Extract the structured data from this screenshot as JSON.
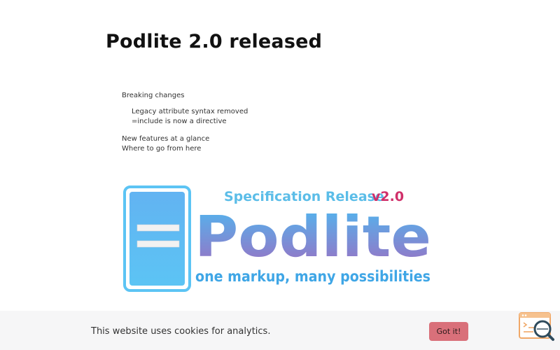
{
  "article": {
    "title": "Podlite 2.0 released"
  },
  "toc": {
    "items": [
      {
        "label": "Breaking changes"
      },
      {
        "label": "Legacy attribute syntax removed"
      },
      {
        "label": "=include is now a directive"
      },
      {
        "label": "New features at a glance"
      },
      {
        "label": "Where to go from here"
      }
    ]
  },
  "banner": {
    "release_label": "Specification Release",
    "version": "v2.0",
    "wordmark": "Podlite",
    "tagline": "one markup, many possibilities",
    "colors": {
      "release_text": "#5bbde8",
      "version_text": "#d0306a",
      "wordmark_top": "#4fb8f0",
      "wordmark_bottom": "#9b6fc2",
      "tagline_text": "#3fa6e6"
    }
  },
  "cookie": {
    "message": "This website uses cookies for analytics.",
    "button_label": "Got it!"
  },
  "widget": {
    "icon": "search-document-icon",
    "accent": "#f0a868"
  }
}
